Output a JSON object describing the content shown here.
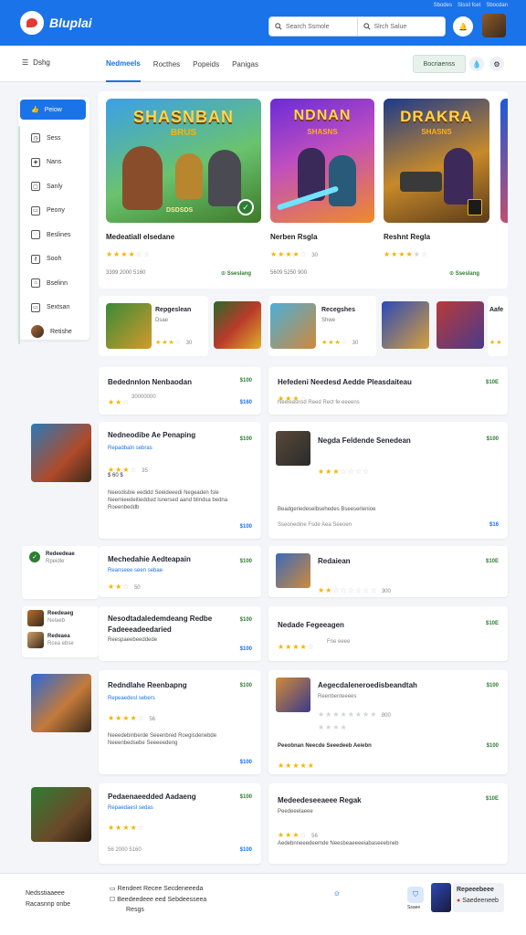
{
  "header": {
    "brand": "Bluplai",
    "top_links": [
      "Sbodes",
      "Slssil fcet",
      "Sbocdan"
    ],
    "search_placeholder": "Search Ssmole",
    "search_placeholder_2": "Slrch Salue",
    "bell_icon": "bell-icon"
  },
  "nav": {
    "menu_label": "Dshg",
    "tabs": [
      "Nedmeels",
      "Rocthes",
      "Popeids",
      "Panigas"
    ],
    "active_tab": 0,
    "pill": "Bocriaenss"
  },
  "sidebar": {
    "active": "Peiow",
    "items": [
      "Sess",
      "Nans",
      "Sanly",
      "Peony",
      "Beslines",
      "Sooh",
      "Bselinn",
      "Sextsan",
      "Retishe"
    ]
  },
  "featured": [
    {
      "art_title": "SHASNBAN",
      "art_sub": "BRUS",
      "art_tag": "DSDSDS",
      "name": "Medeatiall elsedane",
      "stars": 4,
      "meta": "3399 2000 5160",
      "dl": "Sseslang"
    },
    {
      "art_title": "NDNAN",
      "art_sub": "SHASNS",
      "art_tag": "",
      "name": "Nerben Rsgla",
      "stars": 4,
      "meta": "5609 5250 900",
      "dl": ""
    },
    {
      "art_title": "DRAKRA",
      "art_sub": "SHASNS",
      "art_tag": "",
      "name": "Reshnt Regla",
      "stars": 4,
      "meta": "",
      "dl": "Sseslang"
    }
  ],
  "small_cards": [
    {
      "title": "Repgeslean",
      "sub": "Dsae",
      "stars": 3,
      "rating": "30"
    },
    {
      "title": "Recegshes",
      "sub": "Shwe",
      "stars": 3,
      "rating": "30"
    },
    {
      "title": "Aafe",
      "sub": "",
      "stars": 3,
      "rating": ""
    }
  ],
  "list": {
    "c1": {
      "title": "Bedednnlon Nenbaodan",
      "price": "$100",
      "price2": "$160",
      "stars": 2,
      "meta": "30000000"
    },
    "c2": {
      "title": "Hefedeni Needesd Aedde Pleasdaiteau",
      "price": "$10E",
      "meta": "Neeieasnsd Reed Rect fe eeeens"
    },
    "c3": {
      "title": "Nedneodibe Ae Penaping",
      "sub": "Repadbaln sebras",
      "price": "$100",
      "price2": "$100",
      "stars": 3,
      "meta": "35",
      "extra": "$ 60 $",
      "desc": "Neeodisbie eedidd Seeideeedi Negeaden fsle Neemieedeitieddsid lsnersed aand blindsa bedna Roeenbeddb"
    },
    "c4": {
      "title": "Negda Feldende Senedean",
      "price": "$100",
      "price2": "$16",
      "stars": 3,
      "desc": "Beadgeriedeselbsehedes Bseeserlenioe",
      "meta": "Sseonedine Fsde Aea Seeoen"
    },
    "c5": {
      "title": "Mechedahie Aedteapain",
      "sub": "Reanseee seen sebae",
      "price": "$100",
      "stars": 2,
      "meta": "50"
    },
    "c6": {
      "title": "Redaiean",
      "price": "$10E",
      "stars": 2,
      "meta": "300"
    },
    "c7": {
      "title": "Nesodtadaledemdeang Redbe Fadeeeadeedaried",
      "sub": "Reespaeebeeddede",
      "price": "$100",
      "price2": "$100"
    },
    "c8": {
      "title": "Nedade Fegeeagen",
      "price": "$10E",
      "stars": 4,
      "meta": "Fne eeee"
    },
    "c9": {
      "title": "Redndlahe Reenbapng",
      "sub": "Repeaedesl sebers",
      "price": "$100",
      "price2": "$100",
      "stars": 4,
      "meta": "56",
      "desc": "Neeedebinberde Seeenbred Roegisdenebde Neeenbedsebe Seeeeedeng"
    },
    "c10": {
      "title": "Aegecdaleneroedisbeandtah",
      "sub": "Reenbenteeees",
      "price": "$100",
      "price2": "$100",
      "stars": 2,
      "meta": "800",
      "foot": "Peeobnan Neecde Seeedeeb Aeiebn"
    },
    "c11": {
      "title": "Pedaenaeedded Aadaeng",
      "sub": "Repaedaesl sedas",
      "price": "$100",
      "price2": "$100",
      "stars": 4,
      "meta": "56 2000 5160"
    },
    "c12": {
      "title": "Medeedeseeaeee Regak",
      "sub": "Peedeeelaeee",
      "price": "$10E",
      "stars": 3,
      "meta": "56",
      "desc": "Aedebnneeedeemde Neesbeaeeeeiabaseeebneb"
    }
  },
  "left_mini": [
    {
      "title": "Redeedeae",
      "sub": "Rpeidle"
    },
    {
      "title": "Reedeaeg",
      "sub": "Nelaeb"
    },
    {
      "title": "Redeaea",
      "sub": "Rcea ebse"
    }
  ],
  "footer": {
    "left_title": "Nedsstiaaeee",
    "left_sub": "Racasnnp onbe",
    "mid_line1": "Rendeet Recee Secdeneeeda",
    "mid_line2": "Beedeedeee eed Sebdeesseea",
    "mid_line3": "Resgs",
    "right_title": "Repeeebeee",
    "right_sub": "Saedeeneeb",
    "right_badge": "Ssaee"
  },
  "colors": {
    "primary": "#1a73e8",
    "green": "#2e7d32",
    "star": "#f4b400"
  }
}
